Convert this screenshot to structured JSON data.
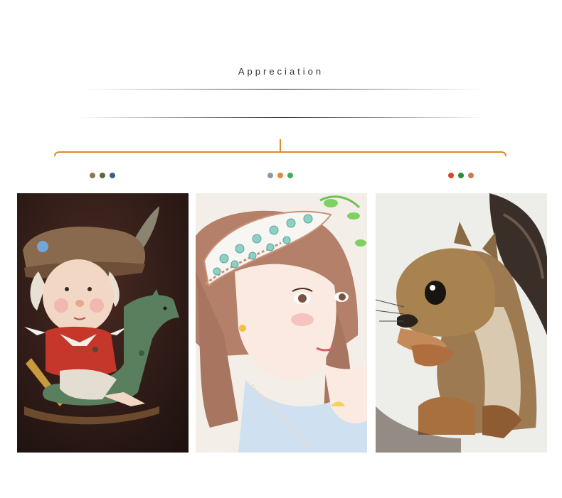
{
  "header": {
    "title": "Appreciation"
  },
  "accent_color": "#e08a2a",
  "gallery": [
    {
      "dots": [
        "#8a7a4e",
        "#5a6a3a",
        "#3c5f8a"
      ],
      "subject": "child-on-rocking-horse"
    },
    {
      "dots": [
        "#8c9aa6",
        "#e08a3a",
        "#3fae5a"
      ],
      "subject": "girl-with-lace-headband"
    },
    {
      "dots": [
        "#d9482b",
        "#2f8a3a",
        "#c97a4e"
      ],
      "subject": "squirrel-drawing"
    }
  ]
}
